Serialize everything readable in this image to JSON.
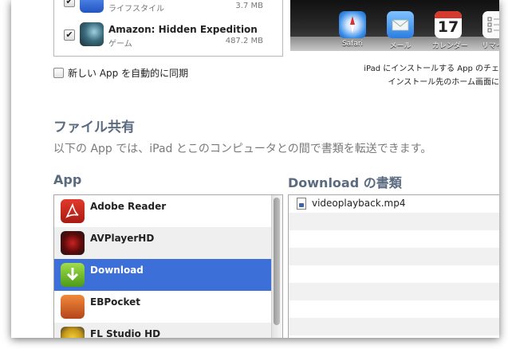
{
  "sync_apps": [
    {
      "name": "",
      "subtitle": "ライフスタイル",
      "size": "3.7 MB",
      "checked": true,
      "icon": "blue-app-icon"
    },
    {
      "name": "Amazon: Hidden Expedition",
      "subtitle": "ゲーム",
      "size": "487.2 MB",
      "checked": true,
      "icon": "game-app-icon"
    }
  ],
  "auto_sync_label": "新しい App を自動的に同期",
  "ipad_apps": [
    {
      "label": "Safari",
      "icon": "compass-icon"
    },
    {
      "label": "メール",
      "icon": "mail-icon"
    },
    {
      "label": "カレンダー",
      "icon": "calendar-icon",
      "day": "17"
    },
    {
      "label": "リマイン",
      "icon": "reminders-icon"
    }
  ],
  "ipad_caption_line1": "iPad にインストールする App のチェ",
  "ipad_caption_line2": "インストール先のホーム画面に",
  "file_sharing": {
    "title": "ファイル共有",
    "description": "以下の App では、iPad とこのコンピュータとの間で書類を転送できます。",
    "apps_header": "App",
    "docs_header": "Download の書類",
    "apps": [
      {
        "name": "Adobe Reader",
        "icon": "adobe-reader-icon",
        "selected": false
      },
      {
        "name": "AVPlayerHD",
        "icon": "avplayer-icon",
        "selected": false
      },
      {
        "name": "Download",
        "icon": "download-app-icon",
        "selected": true
      },
      {
        "name": "EBPocket",
        "icon": "ebpocket-icon",
        "selected": false
      },
      {
        "name": "FL Studio HD",
        "icon": "fl-studio-icon",
        "selected": false
      }
    ],
    "documents": [
      {
        "name": "videoplayback.mp4",
        "icon": "video-file-icon"
      }
    ]
  },
  "colors": {
    "selection": "#3d6fd8",
    "heading": "#5a6b80"
  }
}
